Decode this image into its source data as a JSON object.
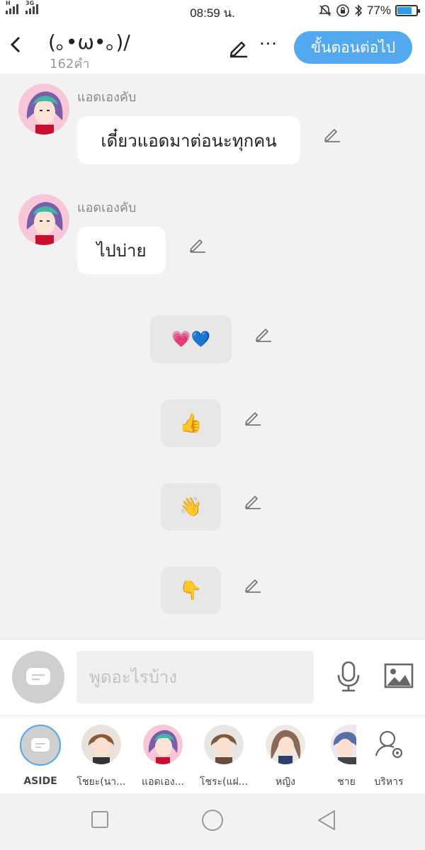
{
  "status_bar": {
    "signal_label": "H",
    "signal2_label": "3G",
    "time": "08:59 น.",
    "battery_percent": "77%",
    "battery_level": 0.77,
    "icons": [
      "mute-icon",
      "rotation-lock-icon",
      "bluetooth-icon",
      "battery-icon"
    ]
  },
  "header": {
    "title": "(｡•ω•｡)/",
    "word_count": "162คำ",
    "next_button": "ขั้นตอนต่อไป",
    "more": "···"
  },
  "messages": [
    {
      "sender": "แอดเองคับ",
      "text": "เดี๋ยวแอดมาต่อนะทุกคน"
    },
    {
      "sender": "แอดเองคับ",
      "text": "ไปบ่าย"
    }
  ],
  "stickers": [
    {
      "emoji": "💗💙",
      "name": "hearts-sticker"
    },
    {
      "emoji": "👍",
      "name": "thumbs-up-sticker"
    },
    {
      "emoji": "👋",
      "name": "wave-sticker"
    },
    {
      "emoji": "👇",
      "name": "point-down-sticker"
    }
  ],
  "input": {
    "placeholder": "พูดอะไรบ้าง"
  },
  "characters": [
    {
      "name": "ASIDE"
    },
    {
      "name": "โชยะ(นา..."
    },
    {
      "name": "แอดเอง..."
    },
    {
      "name": "โชระ(แฝ..."
    },
    {
      "name": "หญิง"
    },
    {
      "name": "ชาย"
    },
    {
      "name": "บริหาร"
    }
  ],
  "colors": {
    "accent": "#52a9ef",
    "background": "#f2f2f2",
    "bubble": "#ffffff",
    "sticker_bg": "#e7e7e7"
  }
}
